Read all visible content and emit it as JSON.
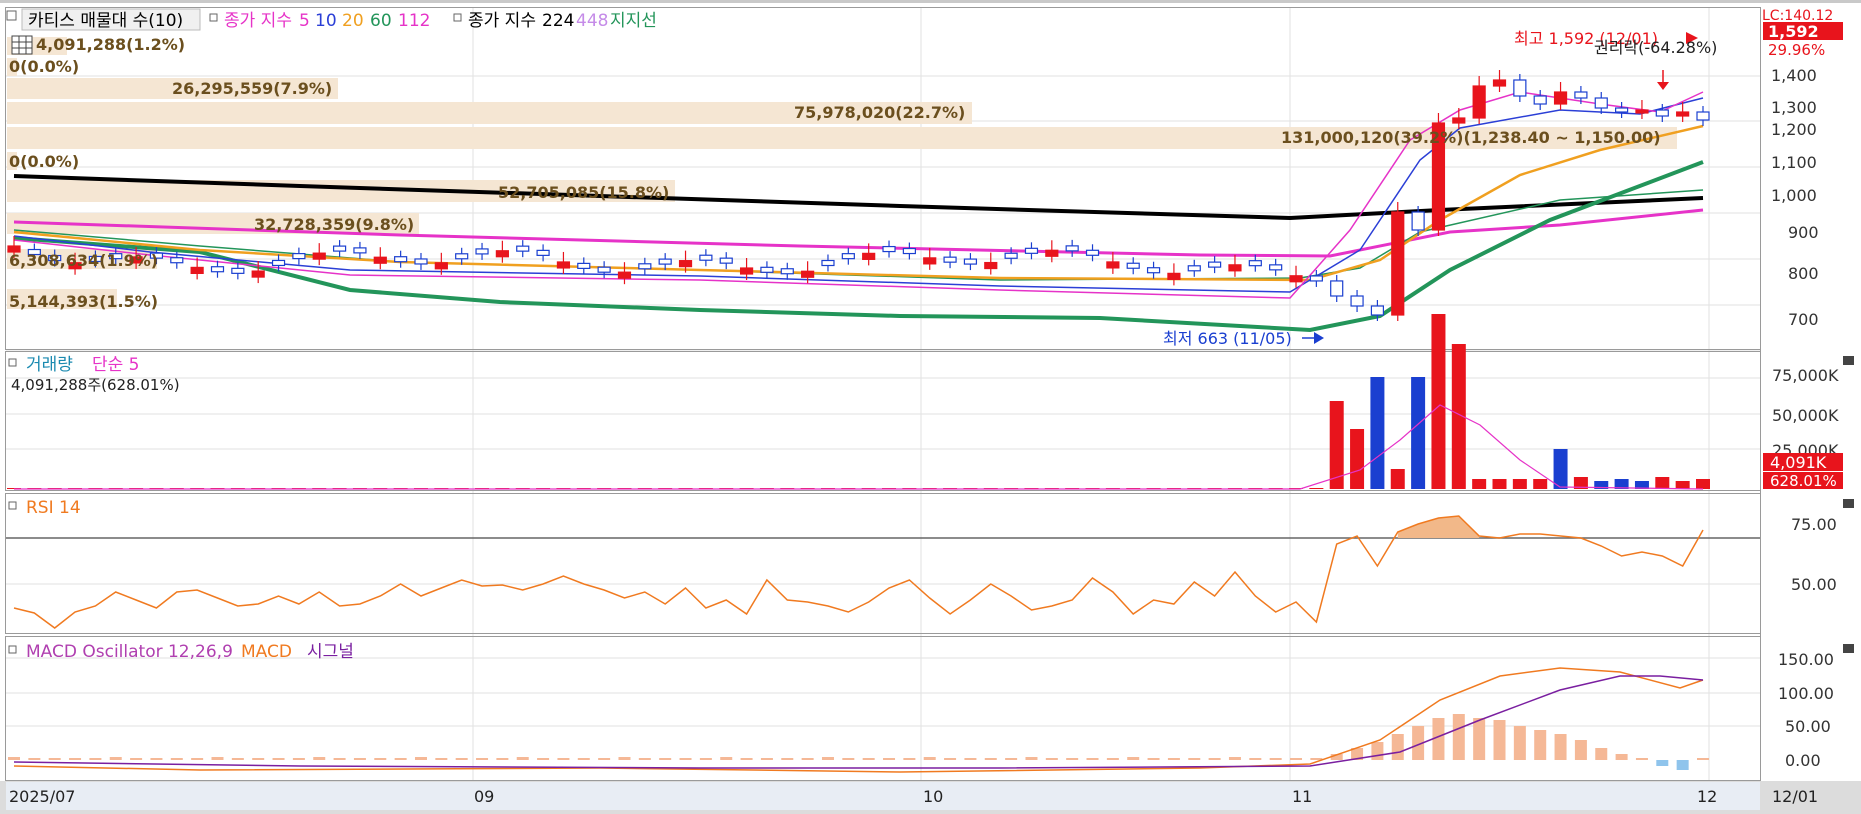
{
  "header": {
    "indicator1": "카티스 매물대 수(10)",
    "ma_label": "종가 지수",
    "ma_periods": [
      "5",
      "10",
      "20",
      "60",
      "112"
    ],
    "ma_colors": [
      "#e633c8",
      "#2b3fd6",
      "#f0a020",
      "#23955a",
      "#e633c8"
    ],
    "ma2_label": "종가 지수",
    "ma2_periods": [
      "224",
      "448"
    ],
    "ma2_colors": [
      "#000000",
      "#c58be8"
    ],
    "support_label": "지지선"
  },
  "top_right": {
    "code": "LC:140.12",
    "last_price_tag": "1,592",
    "change_pct": "29.96%"
  },
  "price_axis": {
    "ticks": [
      "1,400",
      "1,300",
      "1,200",
      "1,100",
      "1,000",
      "900",
      "800",
      "700"
    ]
  },
  "volume_profile": [
    "4,091,288(1.2%)",
    "0(0.0%)",
    "26,295,559(7.9%)",
    "75,978,020(22.7%)",
    "131,000,120(39.2%)(1,238.40 ~ 1,150.00)",
    "0(0.0%)",
    "52,705,085(15.8%)",
    "32,728,359(9.8%)",
    "6,308,634(1.9%)",
    "5,144,393(1.5%)"
  ],
  "annotations": {
    "high": "최고 1,592 (12/01)",
    "low": "최저 663 (11/05)",
    "ex_rights": "권리락(-64.28%)"
  },
  "volume_panel": {
    "title": "거래량",
    "ma_title": "단순 5",
    "current": "4,091,288주(628.01%)",
    "ticks": [
      "75,000K",
      "50,000K",
      "25,000K"
    ],
    "tag_value": "4,091K",
    "tag_pct": "628.01%"
  },
  "rsi_panel": {
    "title": "RSI 14",
    "ticks": [
      "75.00",
      "50.00"
    ]
  },
  "macd_panel": {
    "title": "MACD Oscillator 12,26,9",
    "macd_label": "MACD",
    "signal_label": "시그널",
    "ticks": [
      "150.00",
      "100.00",
      "50.00",
      "0.00"
    ]
  },
  "date_axis": {
    "labels": [
      "2025/07",
      "09",
      "10",
      "11",
      "12"
    ],
    "right_label": "12/01"
  },
  "colors": {
    "up": "#e8141c",
    "down": "#1a3fd0",
    "profile": "#f5e6d3"
  }
}
